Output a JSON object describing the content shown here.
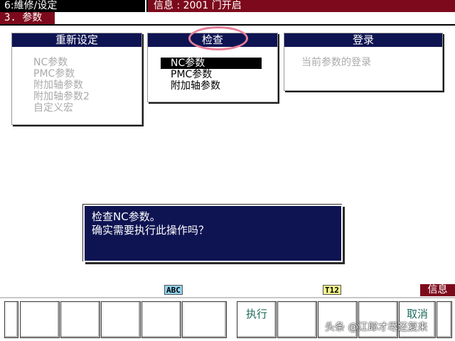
{
  "header": {
    "screen_title": "6:維修/设定",
    "info": "信息 : 2001 门开启",
    "sub_title": "3. 参数"
  },
  "panels": {
    "reset": {
      "title": "重新设定",
      "items": [
        "NC参数",
        "PMC参数",
        "附加轴参数",
        "附加轴参数2",
        "自定义宏"
      ]
    },
    "check": {
      "title": "检查",
      "items": [
        "NC参数",
        "PMC参数",
        "附加轴参数"
      ],
      "selected_index": 0
    },
    "login": {
      "title": "登录",
      "items": [
        "当前参数的登录"
      ]
    }
  },
  "dialog": {
    "line1": "检查NC参数。",
    "line2": "确实需要执行此操作吗？"
  },
  "softkeys": {
    "abc_badge": "ABC",
    "t12_badge": "T12",
    "info_tab": "信息",
    "left_group": [
      "",
      "",
      "",
      "",
      ""
    ],
    "right_group": [
      "执行",
      "",
      "",
      "",
      "取消"
    ]
  },
  "watermark": "头条 @江郎才尽还复来",
  "colors": {
    "header_red": "#7d0a1c",
    "panel_navy": "#0e1452",
    "annotation_pink": "#e77f99",
    "softkey_text": "#1f6b5c"
  }
}
